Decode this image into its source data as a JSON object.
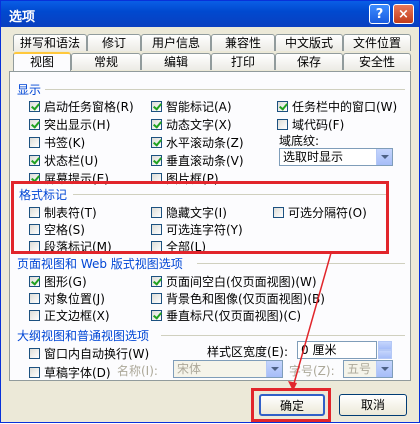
{
  "window": {
    "title": "选项",
    "help_label": "?",
    "close_label": "×"
  },
  "tabs_row1": [
    "拼写和语法",
    "修订",
    "用户信息",
    "兼容性",
    "中文版式",
    "文件位置"
  ],
  "tabs_row2": [
    "视图",
    "常规",
    "编辑",
    "打印",
    "保存",
    "安全性"
  ],
  "show": {
    "title": "显示",
    "items": [
      {
        "label": "启动任务窗格(R)",
        "checked": true
      },
      {
        "label": "智能标记(A)",
        "checked": true
      },
      {
        "label": "任务栏中的窗口(W)",
        "checked": true
      },
      {
        "label": "突出显示(H)",
        "checked": true
      },
      {
        "label": "动态文字(X)",
        "checked": true
      },
      {
        "label": "域代码(F)",
        "checked": false
      },
      {
        "label": "书签(K)",
        "checked": false
      },
      {
        "label": "水平滚动条(Z)",
        "checked": true
      },
      {
        "label": "状态栏(U)",
        "checked": true
      },
      {
        "label": "垂直滚动条(V)",
        "checked": true
      },
      {
        "label": "屏幕提示(E)",
        "checked": true
      },
      {
        "label": "图片框(P)",
        "checked": false
      }
    ],
    "field_shading_label": "域底纹:",
    "field_shading_value": "选取时显示"
  },
  "format_marks": {
    "title": "格式标记",
    "items": [
      {
        "label": "制表符(T)",
        "checked": false
      },
      {
        "label": "隐藏文字(I)",
        "checked": false
      },
      {
        "label": "可选分隔符(O)",
        "checked": false
      },
      {
        "label": "空格(S)",
        "checked": false
      },
      {
        "label": "可选连字符(Y)",
        "checked": false
      },
      {
        "label": "段落标记(M)",
        "checked": false
      },
      {
        "label": "全部(L)",
        "checked": false
      }
    ]
  },
  "print_web": {
    "title": "页面视图和 Web 版式视图选项",
    "items": [
      {
        "label": "图形(G)",
        "checked": true
      },
      {
        "label": "页面间空白(仅页面视图)(W)",
        "checked": true
      },
      {
        "label": "对象位置(J)",
        "checked": false
      },
      {
        "label": "背景色和图像(仅页面视图)(B)",
        "checked": false
      },
      {
        "label": "正文边框(X)",
        "checked": false
      },
      {
        "label": "垂直标尺(仅页面视图)(C)",
        "checked": true
      }
    ]
  },
  "outline": {
    "title": "大纲视图和普通视图选项",
    "wrap_label": "窗口内自动换行(W)",
    "wrap_checked": false,
    "draft_label": "草稿字体(D)",
    "draft_checked": false,
    "name_label": "名称(I):",
    "name_value": "宋体",
    "style_width_label": "样式区宽度(E):",
    "style_width_value": "0 厘米",
    "size_label": "字号(Z):",
    "size_value": "五号"
  },
  "buttons": {
    "ok": "确定",
    "cancel": "取消"
  }
}
